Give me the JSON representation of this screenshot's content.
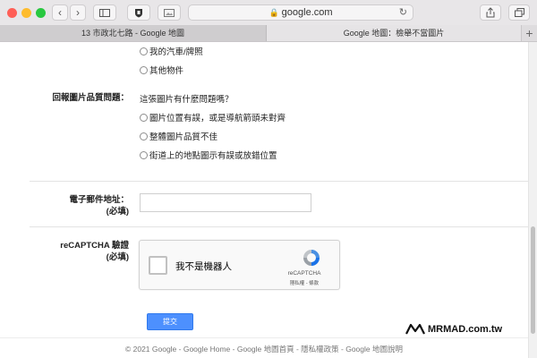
{
  "browser": {
    "url": "google.com",
    "tabs": [
      {
        "label": "13 市政北七路 - Google 地圖"
      },
      {
        "label": "Google 地圖：檢舉不當圖片"
      }
    ],
    "new_tab_label": "+"
  },
  "form": {
    "options_top": [
      "我的汽車/牌照",
      "其他物件"
    ],
    "quality_label": "回報圖片品質問題：",
    "quality_question": "這張圖片有什麼問題嗎？",
    "quality_options": [
      "圖片位置有誤，或是導航箭頭未對齊",
      "整體圖片品質不佳",
      "街道上的地點圖示有誤或放錯位置"
    ],
    "email_label_line1": "電子郵件地址：",
    "email_label_line2": "(必填)",
    "email_value": "",
    "recaptcha_label_line1": "reCAPTCHA 驗證",
    "recaptcha_label_line2": "(必填)",
    "recaptcha_checkbox_text": "我不是機器人",
    "recaptcha_brand": "reCAPTCHA",
    "recaptcha_links": "隱私權 - 條款",
    "submit_label": "提交"
  },
  "footer": {
    "text": "© 2021 Google - Google Home - Google 地圖首頁 - 隱私權政策 - Google 地圖說明"
  },
  "watermark": {
    "text": "MRMAD.com.tw"
  },
  "colors": {
    "submit_bg": "#4d90fe",
    "captcha_blue": "#4a90e2"
  }
}
